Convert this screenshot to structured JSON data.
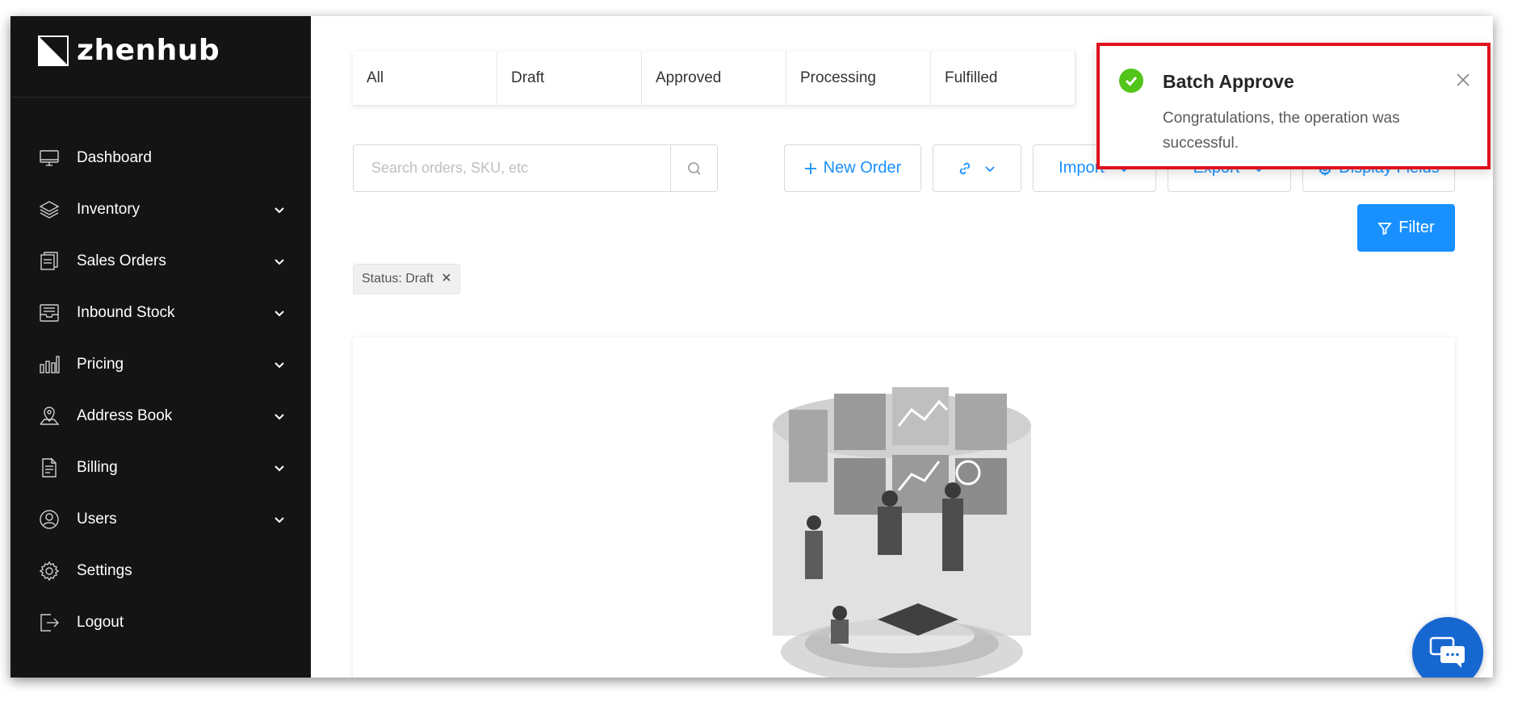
{
  "brand": {
    "name": "zhenhub"
  },
  "sidebar": {
    "items": [
      {
        "label": "Dashboard",
        "icon": "monitor-icon",
        "expandable": false
      },
      {
        "label": "Inventory",
        "icon": "layers-icon",
        "expandable": true
      },
      {
        "label": "Sales Orders",
        "icon": "document-stack-icon",
        "expandable": true
      },
      {
        "label": "Inbound Stock",
        "icon": "inbox-icon",
        "expandable": true
      },
      {
        "label": "Pricing",
        "icon": "bar-chart-icon",
        "expandable": true
      },
      {
        "label": "Address Book",
        "icon": "map-pin-icon",
        "expandable": true
      },
      {
        "label": "Billing",
        "icon": "invoice-icon",
        "expandable": true
      },
      {
        "label": "Users",
        "icon": "user-circle-icon",
        "expandable": true
      },
      {
        "label": "Settings",
        "icon": "gear-icon",
        "expandable": false
      },
      {
        "label": "Logout",
        "icon": "logout-icon",
        "expandable": false
      }
    ]
  },
  "tabs": [
    "All",
    "Draft",
    "Approved",
    "Processing",
    "Fulfilled"
  ],
  "search": {
    "placeholder": "Search orders, SKU, etc"
  },
  "toolbar": {
    "new_order": "New Order",
    "import": "Import",
    "export": "Export",
    "display_fields": "Display Fields",
    "filter": "Filter"
  },
  "filter_tag": {
    "label": "Status: Draft"
  },
  "toast": {
    "title": "Batch Approve",
    "message": "Congratulations, the operation was successful.",
    "status": "success"
  },
  "colors": {
    "sidebar_bg": "#141414",
    "accent": "#1890ff",
    "success": "#52c41a",
    "highlight_border": "#e0121c",
    "chat_bg": "#1767d1"
  }
}
